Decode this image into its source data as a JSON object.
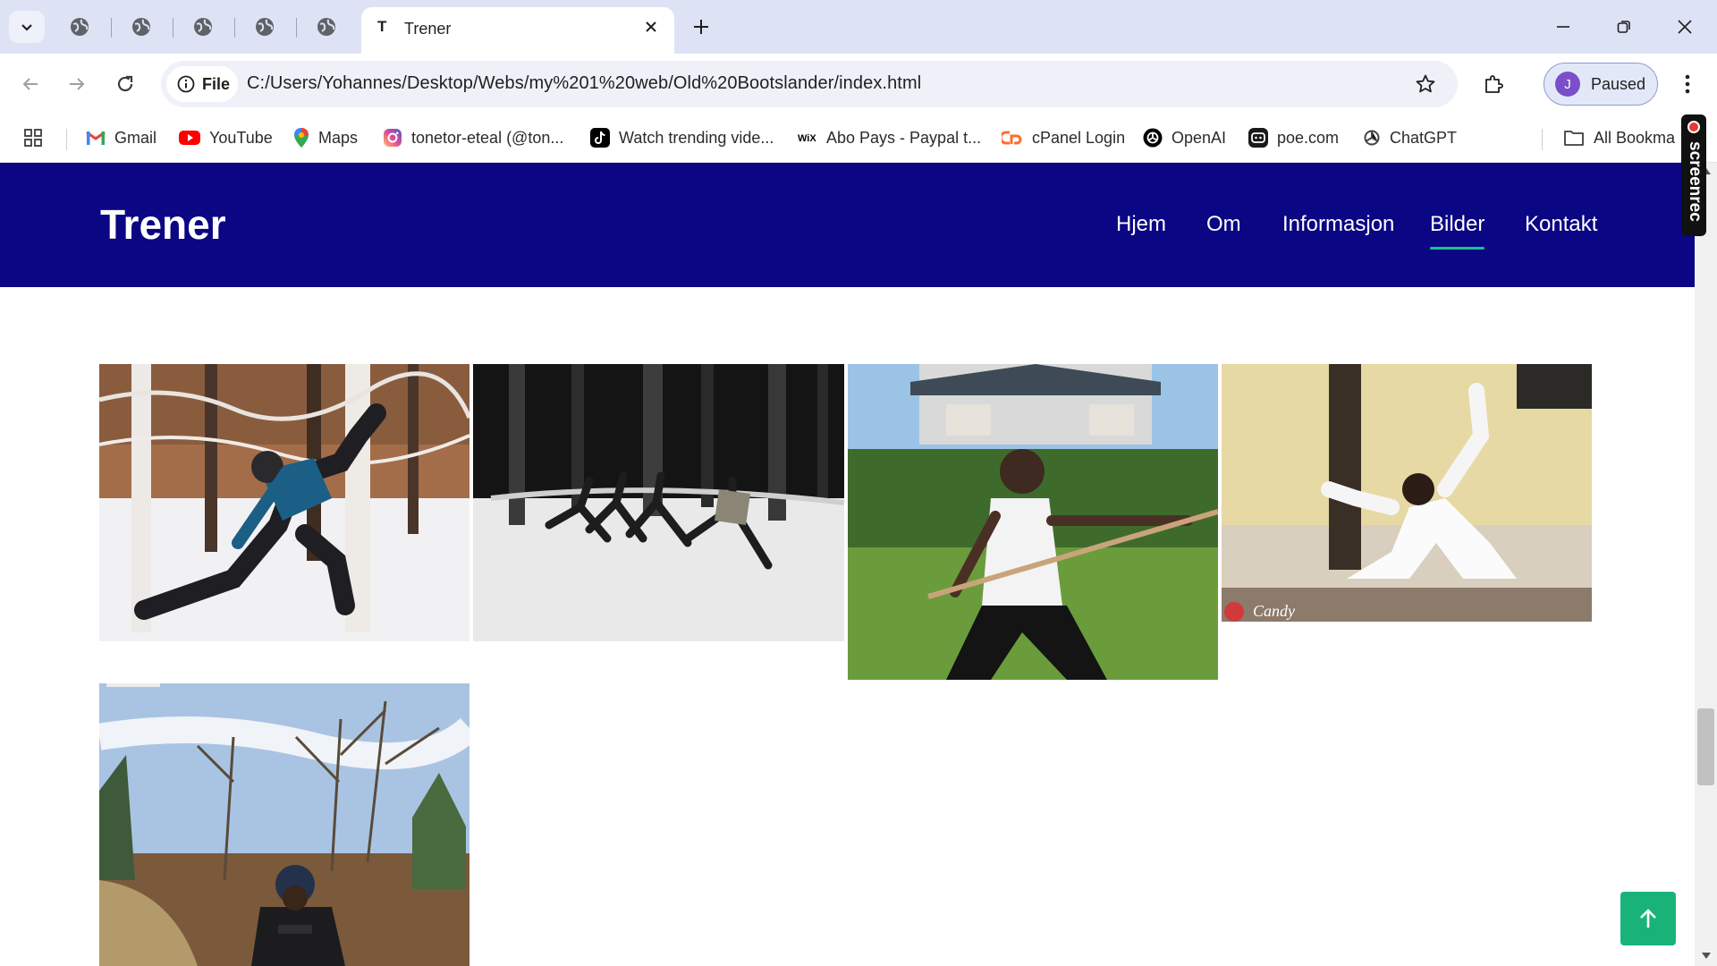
{
  "browser": {
    "active_tab": {
      "favicon": "T",
      "title": "Trener"
    },
    "omnibox": {
      "chip_label": "File",
      "url": "C:/Users/Yohannes/Desktop/Webs/my%201%20web/Old%20Bootslander/index.html"
    },
    "profile": {
      "initial": "J",
      "label": "Paused"
    },
    "bookmarks": [
      {
        "label": "Gmail",
        "icon": "gmail-icon",
        "color": "#ea4335"
      },
      {
        "label": "YouTube",
        "icon": "youtube-icon",
        "color": "#ff0000"
      },
      {
        "label": "Maps",
        "icon": "maps-icon",
        "color": "#34a853"
      },
      {
        "label": "tonetor-eteal (@ton...",
        "icon": "instagram-icon",
        "color": "#d6249f"
      },
      {
        "label": "Watch trending vide...",
        "icon": "tiktok-icon",
        "color": "#000000"
      },
      {
        "label": "Abo Pays - Paypal t...",
        "icon": "wix-icon",
        "color": "#000000"
      },
      {
        "label": "cPanel Login",
        "icon": "cpanel-icon",
        "color": "#ff6c2c"
      },
      {
        "label": "OpenAI",
        "icon": "openai-icon",
        "color": "#000000"
      },
      {
        "label": "poe.com",
        "icon": "poe-icon",
        "color": "#000000"
      },
      {
        "label": "ChatGPT",
        "icon": "chatgpt-icon",
        "color": "#444444"
      }
    ],
    "all_bookmarks": "All Bookma"
  },
  "site": {
    "logo": "Trener",
    "nav": [
      {
        "label": "Hjem",
        "active": false
      },
      {
        "label": "Om",
        "active": false
      },
      {
        "label": "Informasjon",
        "active": false
      },
      {
        "label": "Bilder",
        "active": true
      },
      {
        "label": "Kontakt",
        "active": false
      }
    ],
    "header_color": "#0b0683",
    "accent_color": "#19b37a",
    "gallery": [
      {
        "icon": "photo-snowy-lunge"
      },
      {
        "icon": "photo-night-group-training"
      },
      {
        "icon": "photo-staff-training-garden"
      },
      {
        "icon": "photo-white-uniform-kungfu"
      },
      {
        "icon": "photo-forest-salute"
      }
    ],
    "watermark_text": "Candy"
  },
  "overlay": {
    "screenrec_label": "screenrec"
  }
}
